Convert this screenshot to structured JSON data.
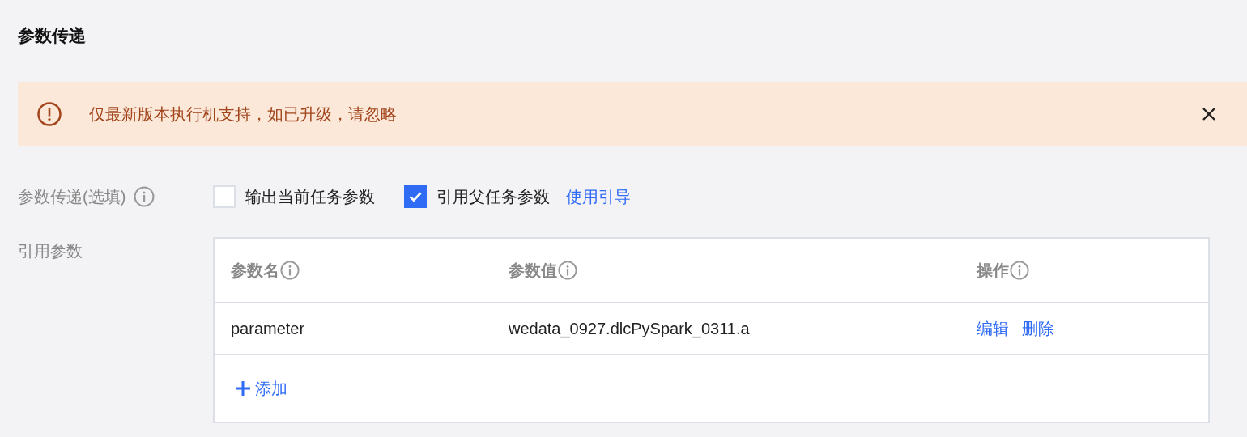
{
  "title": "参数传递",
  "alert": {
    "kind": "warning",
    "message": "仅最新版本执行机支持，如已升级，请忽略",
    "closable": true
  },
  "pass_option": {
    "label": "参数传递(选填)",
    "options": [
      {
        "label": "输出当前任务参数",
        "checked": false
      },
      {
        "label": "引用父任务参数",
        "checked": true
      }
    ],
    "guide_link": "使用引导"
  },
  "ref_params": {
    "label": "引用参数",
    "table": {
      "columns": [
        "参数名",
        "参数值",
        "操作"
      ],
      "rows": [
        {
          "name": "parameter",
          "value": "wedata_0927.dlcPySpark_0311.a",
          "actions": [
            "编辑",
            "删除"
          ]
        }
      ],
      "add_button": "添加"
    }
  }
}
